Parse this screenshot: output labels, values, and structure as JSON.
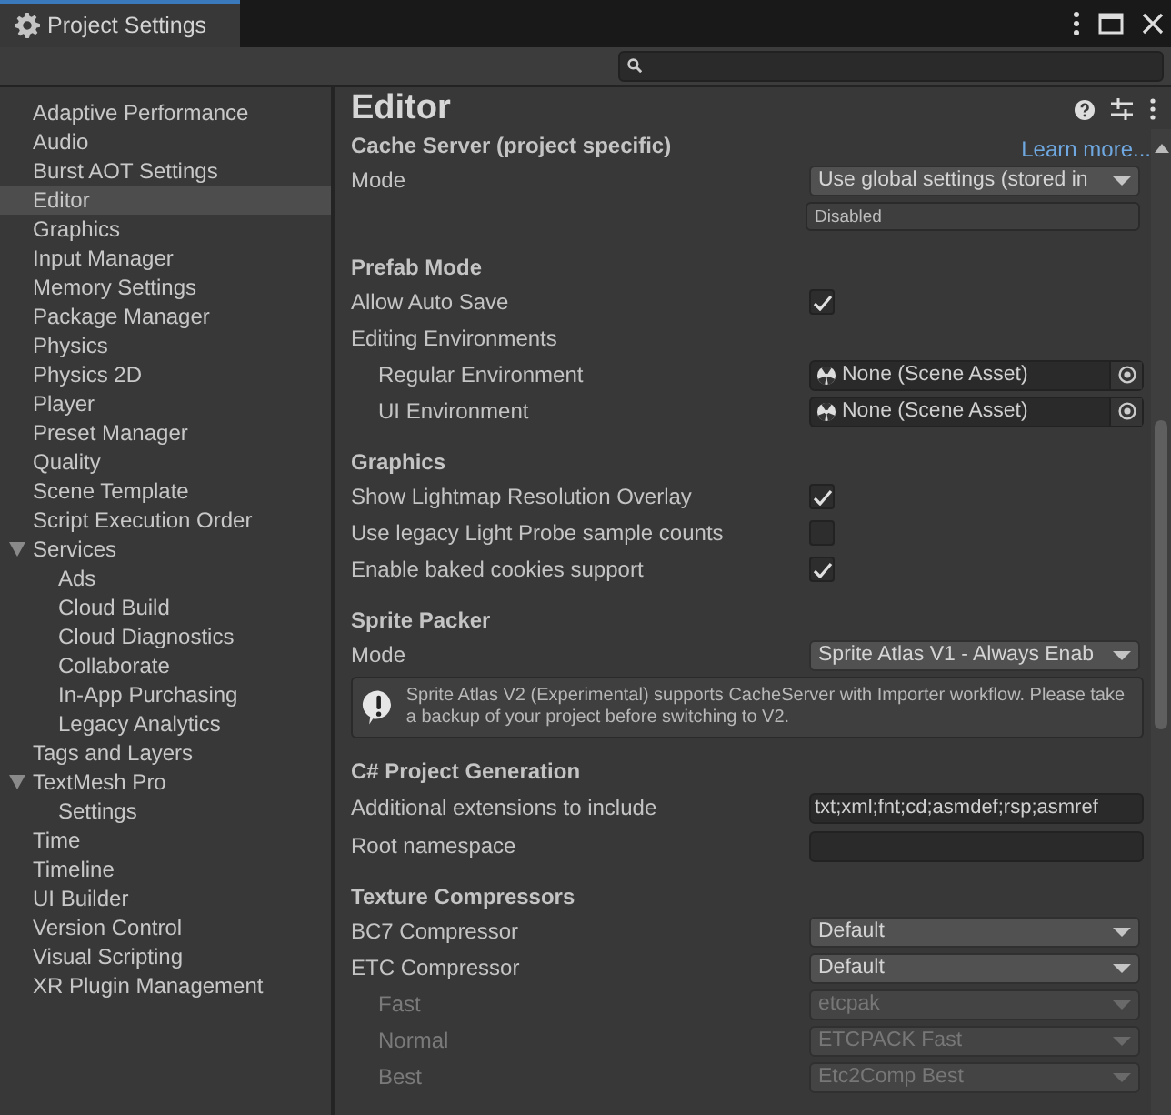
{
  "window": {
    "tab_title": "Project Settings"
  },
  "sidebar": {
    "items": [
      {
        "label": "Adaptive Performance",
        "selected": false
      },
      {
        "label": "Audio",
        "selected": false
      },
      {
        "label": "Burst AOT Settings",
        "selected": false
      },
      {
        "label": "Editor",
        "selected": true
      },
      {
        "label": "Graphics",
        "selected": false
      },
      {
        "label": "Input Manager",
        "selected": false
      },
      {
        "label": "Memory Settings",
        "selected": false
      },
      {
        "label": "Package Manager",
        "selected": false
      },
      {
        "label": "Physics",
        "selected": false
      },
      {
        "label": "Physics 2D",
        "selected": false
      },
      {
        "label": "Player",
        "selected": false
      },
      {
        "label": "Preset Manager",
        "selected": false
      },
      {
        "label": "Quality",
        "selected": false
      },
      {
        "label": "Scene Template",
        "selected": false
      },
      {
        "label": "Script Execution Order",
        "selected": false
      },
      {
        "label": "Services",
        "selected": false,
        "expanded": true,
        "children": [
          {
            "label": "Ads",
            "selected": false
          },
          {
            "label": "Cloud Build",
            "selected": false
          },
          {
            "label": "Cloud Diagnostics",
            "selected": false
          },
          {
            "label": "Collaborate",
            "selected": false
          },
          {
            "label": "In-App Purchasing",
            "selected": false
          },
          {
            "label": "Legacy Analytics",
            "selected": false
          }
        ]
      },
      {
        "label": "Tags and Layers",
        "selected": false
      },
      {
        "label": "TextMesh Pro",
        "selected": false,
        "expanded": true,
        "children": [
          {
            "label": "Settings",
            "selected": false
          }
        ]
      },
      {
        "label": "Time",
        "selected": false
      },
      {
        "label": "Timeline",
        "selected": false
      },
      {
        "label": "UI Builder",
        "selected": false
      },
      {
        "label": "Version Control",
        "selected": false
      },
      {
        "label": "Visual Scripting",
        "selected": false
      },
      {
        "label": "XR Plugin Management",
        "selected": false
      }
    ]
  },
  "panel": {
    "title": "Editor",
    "rows": [
      {
        "kind": "header",
        "label": "Cache Server (project specific)",
        "link": "Learn more..."
      },
      {
        "kind": "dropdown",
        "label": "Mode",
        "value": "Use global settings (stored in",
        "disabled": false
      },
      {
        "kind": "status_field",
        "value": "Disabled"
      },
      {
        "kind": "header",
        "label": "Prefab Mode"
      },
      {
        "kind": "checkbox",
        "label": "Allow Auto Save",
        "checked": true
      },
      {
        "kind": "label",
        "label": "Editing Environments",
        "children": [
          {
            "kind": "object_field",
            "label": "Regular Environment",
            "value": "None (Scene Asset)"
          },
          {
            "kind": "object_field",
            "label": "UI Environment",
            "value": "None (Scene Asset)"
          }
        ]
      },
      {
        "kind": "header",
        "label": "Graphics"
      },
      {
        "kind": "checkbox",
        "label": "Show Lightmap Resolution Overlay",
        "checked": true
      },
      {
        "kind": "checkbox",
        "label": "Use legacy Light Probe sample counts",
        "checked": false
      },
      {
        "kind": "checkbox",
        "label": "Enable baked cookies support",
        "checked": true
      },
      {
        "kind": "header",
        "label": "Sprite Packer"
      },
      {
        "kind": "dropdown",
        "label": "Mode",
        "value": "Sprite Atlas V1 - Always Enab",
        "disabled": false
      },
      {
        "kind": "help_box",
        "text": "Sprite Atlas V2 (Experimental) supports CacheServer with Importer workflow. Please take a backup of your project before switching to V2."
      },
      {
        "kind": "header",
        "label": "C# Project Generation"
      },
      {
        "kind": "text_field",
        "label": "Additional extensions to include",
        "value": "txt;xml;fnt;cd;asmdef;rsp;asmref"
      },
      {
        "kind": "text_field",
        "label": "Root namespace",
        "value": ""
      },
      {
        "kind": "header",
        "label": "Texture Compressors"
      },
      {
        "kind": "dropdown",
        "label": "BC7 Compressor",
        "value": "Default",
        "disabled": false
      },
      {
        "kind": "dropdown",
        "label": "ETC Compressor",
        "value": "Default",
        "disabled": false,
        "children": [
          {
            "kind": "dropdown",
            "label": "Fast",
            "value": "etcpak",
            "disabled": true
          },
          {
            "kind": "dropdown",
            "label": "Normal",
            "value": "ETCPACK Fast",
            "disabled": true
          },
          {
            "kind": "dropdown",
            "label": "Best",
            "value": "Etc2Comp Best",
            "disabled": true
          }
        ]
      }
    ]
  }
}
